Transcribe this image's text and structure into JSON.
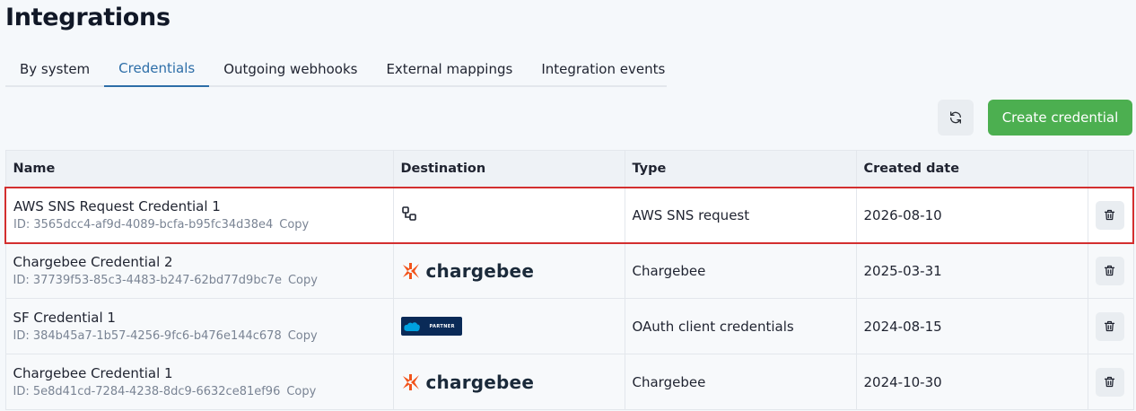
{
  "page": {
    "title": "Integrations"
  },
  "tabs": [
    {
      "label": "By system",
      "active": false
    },
    {
      "label": "Credentials",
      "active": true
    },
    {
      "label": "Outgoing webhooks",
      "active": false
    },
    {
      "label": "External mappings",
      "active": false
    },
    {
      "label": "Integration events",
      "active": false
    }
  ],
  "toolbar": {
    "refresh_icon": "refresh-icon",
    "create_label": "Create credential"
  },
  "colors": {
    "accent": "#2d6ea8",
    "create_button": "#4caf50",
    "selection_outline": "#d32f2f"
  },
  "table": {
    "columns": [
      "Name",
      "Destination",
      "Type",
      "Created date",
      ""
    ],
    "rows": [
      {
        "name": "AWS SNS Request Credential 1",
        "id": "ID: 3565dcc4-af9d-4089-bcfa-b95fc34d38e4",
        "copy": "Copy",
        "destination": "generic-integration-icon",
        "type": "AWS SNS request",
        "created": "2026-08-10",
        "selected": true
      },
      {
        "name": "Chargebee Credential 2",
        "id": "ID: 37739f53-85c3-4483-b247-62bd77d9bc7e",
        "copy": "Copy",
        "destination": "chargebee",
        "destination_label": "chargebee",
        "type": "Chargebee",
        "created": "2025-03-31"
      },
      {
        "name": "SF Credential 1",
        "id": "ID: 384b45a7-1b57-4256-9fc6-b476e144c678",
        "copy": "Copy",
        "destination": "salesforce-partner",
        "destination_badge": "PARTNER",
        "type": "OAuth client credentials",
        "created": "2024-08-15"
      },
      {
        "name": "Chargebee Credential 1",
        "id": "ID: 5e8d41cd-7284-4238-8dc9-6632ce81ef96",
        "copy": "Copy",
        "destination": "chargebee",
        "destination_label": "chargebee",
        "type": "Chargebee",
        "created": "2024-10-30"
      }
    ]
  }
}
